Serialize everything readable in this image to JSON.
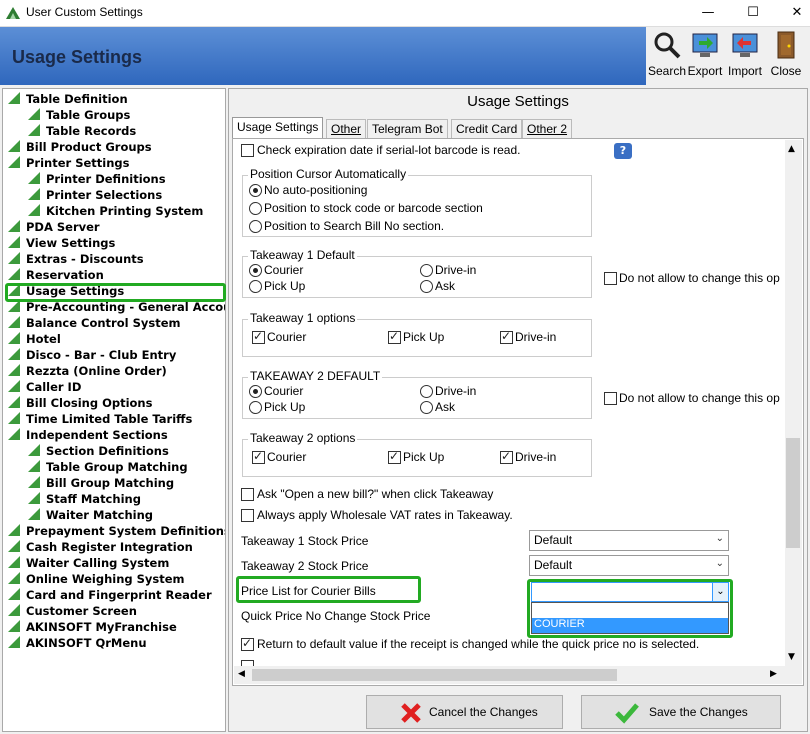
{
  "window": {
    "title": "User Custom Settings",
    "minimize": "—",
    "maximize": "☐",
    "close": "✕"
  },
  "header": {
    "title": "Usage Settings"
  },
  "toolbar": [
    {
      "label": "Search",
      "icon": "search-icon"
    },
    {
      "label": "Export",
      "icon": "export-icon"
    },
    {
      "label": "Import",
      "icon": "import-icon"
    },
    {
      "label": "Close",
      "icon": "close-door-icon"
    }
  ],
  "tree": [
    {
      "label": "Table Definition",
      "level": 0
    },
    {
      "label": "Table Groups",
      "level": 1
    },
    {
      "label": "Table Records",
      "level": 1
    },
    {
      "label": "Bill Product Groups",
      "level": 0
    },
    {
      "label": "Printer Settings",
      "level": 0
    },
    {
      "label": "Printer Definitions",
      "level": 1
    },
    {
      "label": "Printer Selections",
      "level": 1
    },
    {
      "label": "Kitchen Printing System",
      "level": 1
    },
    {
      "label": "PDA Server",
      "level": 0
    },
    {
      "label": "View Settings",
      "level": 0
    },
    {
      "label": "Extras - Discounts",
      "level": 0
    },
    {
      "label": "Reservation",
      "level": 0
    },
    {
      "label": "Usage Settings",
      "level": 0
    },
    {
      "label": "Pre-Accounting - General Accounting",
      "level": 0
    },
    {
      "label": "Balance Control System",
      "level": 0
    },
    {
      "label": "Hotel",
      "level": 0
    },
    {
      "label": "Disco - Bar - Club Entry",
      "level": 0
    },
    {
      "label": "Rezzta (Online Order)",
      "level": 0
    },
    {
      "label": "Caller ID",
      "level": 0
    },
    {
      "label": "Bill Closing Options",
      "level": 0
    },
    {
      "label": "Time Limited Table Tariffs",
      "level": 0
    },
    {
      "label": "Independent Sections",
      "level": 0
    },
    {
      "label": "Section Definitions",
      "level": 1
    },
    {
      "label": "Table Group Matching",
      "level": 1
    },
    {
      "label": "Bill Group Matching",
      "level": 1
    },
    {
      "label": "Staff Matching",
      "level": 1
    },
    {
      "label": "Waiter Matching",
      "level": 1
    },
    {
      "label": "Prepayment System Definitions",
      "level": 0
    },
    {
      "label": "Cash Register Integration",
      "level": 0
    },
    {
      "label": "Waiter Calling System",
      "level": 0
    },
    {
      "label": "Online Weighing System",
      "level": 0
    },
    {
      "label": "Card and Fingerprint Reader",
      "level": 0
    },
    {
      "label": "Customer Screen",
      "level": 0
    },
    {
      "label": "AKINSOFT MyFranchise",
      "level": 0
    },
    {
      "label": "AKINSOFT QrMenu",
      "level": 0
    }
  ],
  "panel": {
    "title": "Usage Settings",
    "tabs": [
      "Usage Settings",
      "Other",
      "Telegram Bot",
      "Credit Card",
      "Other 2"
    ],
    "check_expiration": "Check expiration date if serial-lot barcode is read.",
    "help": "?",
    "cursor_group": {
      "title": "Position Cursor Automatically",
      "options": [
        "No auto-positioning",
        "Position to stock code or barcode section",
        "Position to Search Bill No section."
      ]
    },
    "ta1_default": {
      "title": "Takeaway 1 Default",
      "courier": "Courier",
      "pickup": "Pick Up",
      "drivein": "Drive-in",
      "ask": "Ask"
    },
    "ta1_options": {
      "title": "Takeaway 1 options",
      "courier": "Courier",
      "pickup": "Pick Up",
      "drivein": "Drive-in"
    },
    "ta2_default": {
      "title": "TAKEAWAY 2 DEFAULT",
      "courier": "Courier",
      "pickup": "Pick Up",
      "drivein": "Drive-in",
      "ask": "Ask"
    },
    "ta2_options": {
      "title": "Takeaway 2 options",
      "courier": "Courier",
      "pickup": "Pick Up",
      "drivein": "Drive-in"
    },
    "no_change_1": "Do not allow to change this op",
    "no_change_2": "Do not allow to change this op",
    "ask_new_bill": "Ask \"Open a new bill?\" when click Takeaway",
    "wholesale_vat": "Always apply Wholesale VAT rates in Takeaway.",
    "ta1_stock_price": {
      "label": "Takeaway 1 Stock Price",
      "value": "Default"
    },
    "ta2_stock_price": {
      "label": "Takeaway 2 Stock Price",
      "value": "Default"
    },
    "price_list_courier": {
      "label": "Price List for Courier Bills",
      "value": "",
      "options": [
        "",
        "COURIER"
      ]
    },
    "quick_price": "Quick Price No Change Stock Price",
    "return_default": "Return to default value if the receipt is changed while the quick price no is selected."
  },
  "buttons": {
    "cancel": "Cancel the Changes",
    "save": "Save the Changes"
  },
  "colors": {
    "highlight": "#22aa22",
    "selected_option": "#3399ff",
    "tree_icon": "#3c9a3c"
  }
}
